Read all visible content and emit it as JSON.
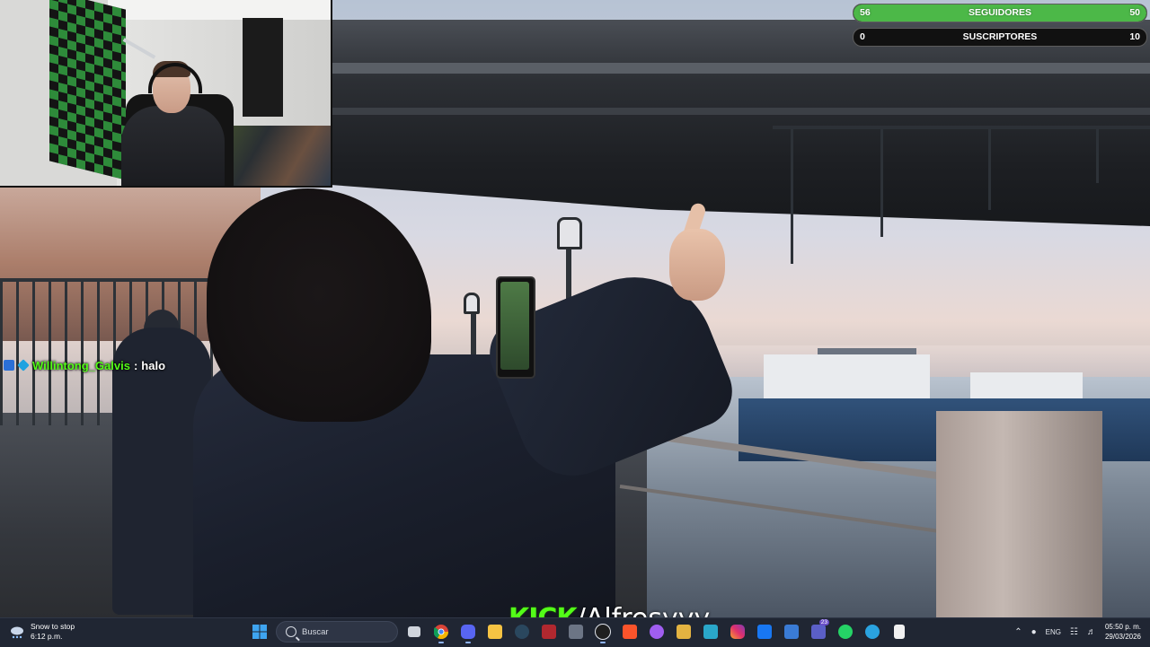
{
  "goals": {
    "followers": {
      "label": "SEGUIDORES",
      "current": "56",
      "target": "50",
      "progress": 1.0,
      "color": "#4cb848"
    },
    "subscribers": {
      "label": "SUSCRIPTORES",
      "current": "0",
      "target": "10",
      "progress": 0.0,
      "color": "#3a3a3a"
    }
  },
  "chat": {
    "username": "Willintong_Galvis",
    "separator": ":",
    "message": "halo"
  },
  "watermark": {
    "logo": "KICK",
    "handle": "/Alfresyyy"
  },
  "taskbar": {
    "weather_line1": "Snow to stop",
    "weather_line2": "6:12 p.m.",
    "search_placeholder": "Buscar",
    "notification_count": "23",
    "language": "ENG",
    "time": "05:50 p. m.",
    "date": "29/03/2026",
    "icons": [
      "windows-start-icon",
      "search-icon",
      "copilot-icon",
      "task-view-icon",
      "chrome-icon",
      "discord-icon",
      "file-explorer-icon",
      "steam-icon",
      "media-icon",
      "app-icon",
      "obs-icon",
      "brave-icon",
      "messenger-icon",
      "folder-icon",
      "app-icon-2",
      "instagram-icon",
      "facebook-icon",
      "store-icon",
      "teams-icon",
      "whatsapp-icon",
      "telegram-icon",
      "document-icon"
    ]
  }
}
